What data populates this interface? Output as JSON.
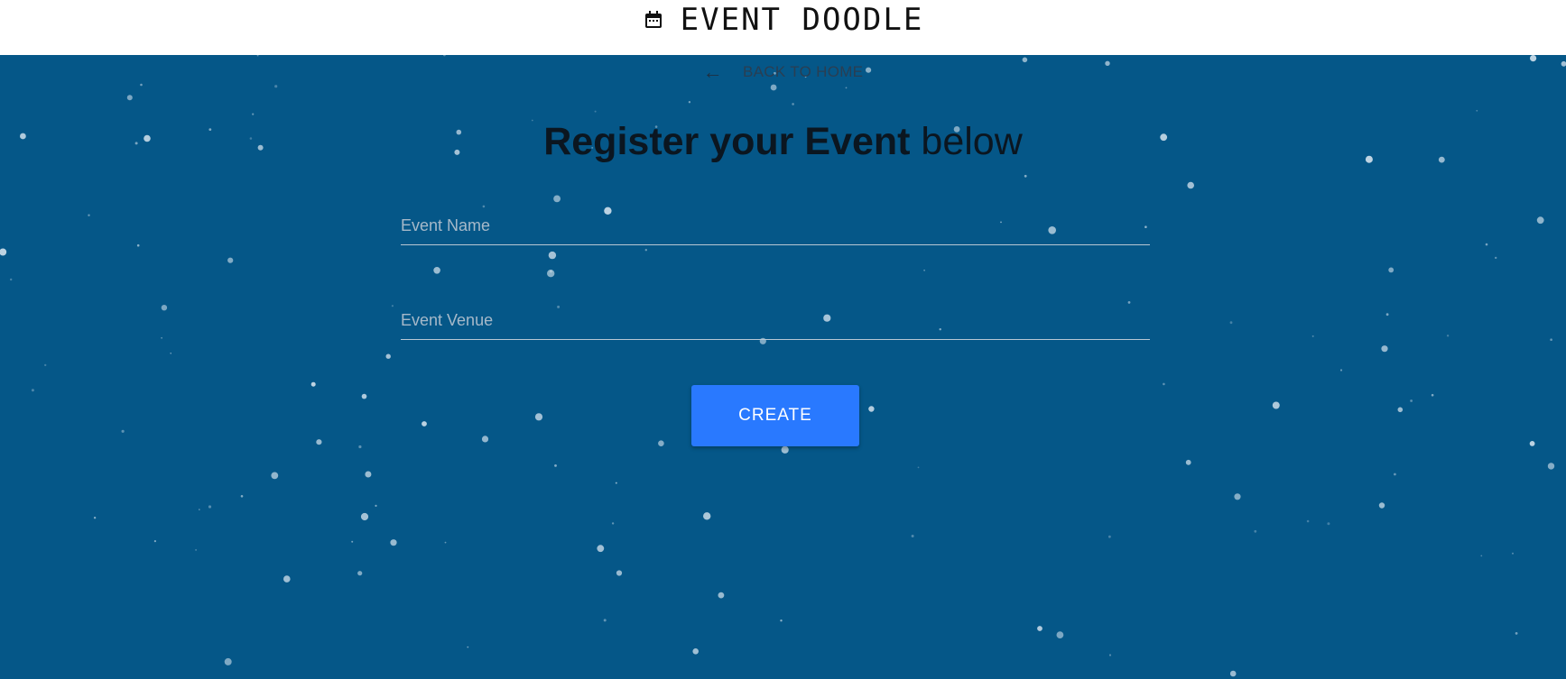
{
  "header": {
    "brand_icon": "calendar-icon",
    "brand_text": "EVENT DOODLE"
  },
  "nav": {
    "back_icon": "arrow-left-icon",
    "back_label": "BACK TO HOME"
  },
  "form": {
    "title_bold": "Register your Event",
    "title_rest": "below",
    "event_name_placeholder": "Event Name",
    "event_name_value": "",
    "event_venue_placeholder": "Event Venue",
    "event_venue_value": "",
    "create_label": "CREATE"
  },
  "colors": {
    "background": "#055788",
    "header_bg": "#ffffff",
    "button": "#2979ff",
    "particle": "#c9dbe8"
  }
}
